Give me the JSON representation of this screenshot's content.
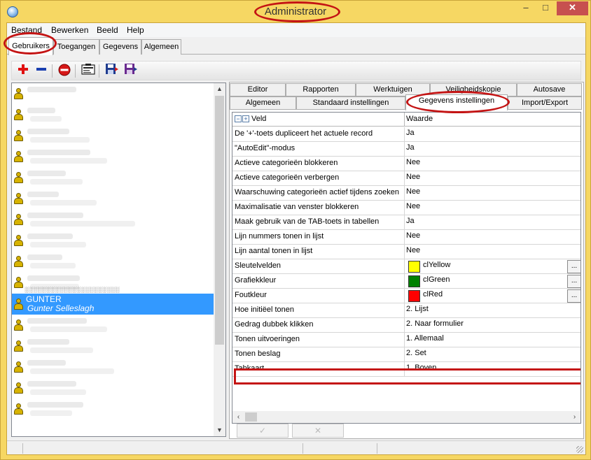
{
  "window": {
    "title": "Administrator"
  },
  "menu": [
    "Bestand",
    "Bewerken",
    "Beeld",
    "Help"
  ],
  "main_tabs": [
    "Gebruikers",
    "Toegangen",
    "Gegevens",
    "Algemeen"
  ],
  "toolbar": {
    "icons": [
      "add-icon",
      "remove-icon",
      "delete-icon",
      "user-card-icon",
      "save-icon",
      "save-as-icon"
    ]
  },
  "users": {
    "selected": {
      "name": "GUNTER",
      "full_name": "Gunter Selleslagh"
    }
  },
  "settings_tabs": {
    "row1": [
      "Editor",
      "Rapporten",
      "Werktuigen",
      "Veiligheidskopie",
      "Autosave"
    ],
    "row2": [
      "Algemeen",
      "Standaard instellingen",
      "Gegevens instellingen",
      "Import/Export"
    ]
  },
  "grid": {
    "headers": {
      "veld": "Veld",
      "waarde": "Waarde"
    },
    "rows": [
      {
        "veld": "De '+'-toets dupliceert het actuele record",
        "waarde": "Ja"
      },
      {
        "veld": "\"AutoEdit\"-modus",
        "waarde": "Ja"
      },
      {
        "veld": "Actieve categorieën blokkeren",
        "waarde": "Nee"
      },
      {
        "veld": "Actieve categorieën verbergen",
        "waarde": "Nee"
      },
      {
        "veld": "Waarschuwing categorieën actief tijdens zoeken",
        "waarde": "Nee"
      },
      {
        "veld": "Maximalisatie van venster blokkeren",
        "waarde": "Nee"
      },
      {
        "veld": "Maak gebruik van de TAB-toets in tabellen",
        "waarde": "Ja"
      },
      {
        "veld": "Lijn nummers tonen in lijst",
        "waarde": "Nee"
      },
      {
        "veld": "Lijn aantal tonen in lijst",
        "waarde": "Nee"
      },
      {
        "veld": "Sleutelvelden",
        "waarde": "clYellow",
        "color": "#ffff00"
      },
      {
        "veld": "Grafiekkleur",
        "waarde": "clGreen",
        "color": "#008000"
      },
      {
        "veld": "Foutkleur",
        "waarde": "clRed",
        "color": "#ff0000"
      },
      {
        "veld": "Hoe initiëel tonen",
        "waarde": "2. Lijst"
      },
      {
        "veld": "Gedrag dubbek klikken",
        "waarde": "2. Naar formulier"
      },
      {
        "veld": "Tonen uitvoeringen",
        "waarde": "1. Allemaal"
      },
      {
        "veld": "Tonen beslag",
        "waarde": "2. Set"
      },
      {
        "veld": "Tabkaart",
        "waarde": "1. Boven"
      }
    ],
    "ellipsis_label": "..."
  },
  "colors": {
    "highlight_oval": "#c41414",
    "selection": "#3399ff",
    "frame": "#f6d763"
  }
}
